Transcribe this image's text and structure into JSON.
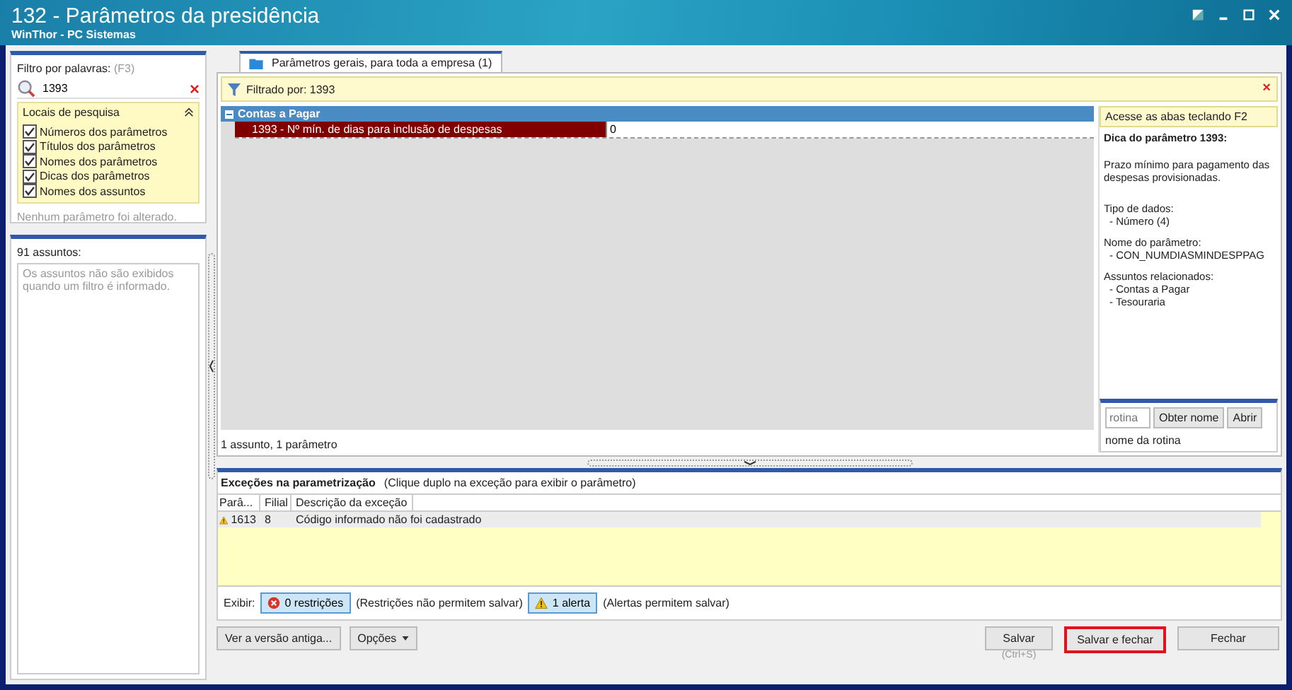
{
  "window": {
    "title": "132 - Parâmetros da presidência",
    "subtitle": "WinThor - PC Sistemas"
  },
  "filter": {
    "label": "Filtro por palavras:",
    "shortcut": "(F3)",
    "value": "1393",
    "clear": "×"
  },
  "search_places": {
    "title": "Locais de pesquisa",
    "expanded": true,
    "options": [
      {
        "label": "Números dos parâmetros",
        "checked": true
      },
      {
        "label": "Títulos dos parâmetros",
        "checked": true
      },
      {
        "label": "Nomes dos parâmetros",
        "checked": true
      },
      {
        "label": "Dicas dos parâmetros",
        "checked": true
      },
      {
        "label": "Nomes dos assuntos",
        "checked": true
      }
    ]
  },
  "changes_note": "Nenhum parâmetro foi alterado.",
  "subjects": {
    "title": "91 assuntos:",
    "message": "Os assuntos não são exibidos quando um filtro é informado."
  },
  "tabs": [
    {
      "label": "Parâmetros gerais, para toda a empresa  (1)",
      "selected": true
    }
  ],
  "filter_bar": {
    "text": "Filtrado por: 1393",
    "clear": "×"
  },
  "groups": [
    {
      "title": "Contas a Pagar",
      "expanded": true,
      "rows": [
        {
          "label": "1393 - Nº mín. de dias para inclusão de despesas",
          "value": "0",
          "selected": true
        }
      ]
    }
  ],
  "grid_status": "1 assunto, 1 parâmetro",
  "tip": {
    "hint": "Acesse as abas teclando F2",
    "title": "Dica do parâmetro 1393:",
    "description": "Prazo mínimo para pagamento das despesas provisionadas.",
    "sections": [
      {
        "heading": "Tipo de dados:",
        "items": [
          "- Número (4)"
        ]
      },
      {
        "heading": "Nome do parâmetro:",
        "items": [
          "- CON_NUMDIASMINDESPPAG"
        ]
      },
      {
        "heading": "Assuntos relacionados:",
        "items": [
          "- Contas a Pagar",
          "- Tesouraria"
        ]
      }
    ]
  },
  "routine": {
    "placeholder": "rotina",
    "get_name": "Obter nome",
    "open": "Abrir",
    "name": "nome da rotina"
  },
  "exceptions": {
    "title": "Exceções na parametrização",
    "hint": "(Clique duplo na exceção para exibir o parâmetro)",
    "columns": [
      "Parâ...",
      "Filial",
      "Descrição da exceção"
    ],
    "rows": [
      {
        "kind": "alert",
        "cells": [
          "1613",
          "8",
          "Código informado não foi cadastrado"
        ],
        "selected": true
      }
    ]
  },
  "show": {
    "label": "Exibir:",
    "filters": [
      {
        "kind": "error",
        "label": "0 restrições",
        "note": "(Restrições não permitem salvar)",
        "pressed": true
      },
      {
        "kind": "alert",
        "label": "1 alerta",
        "note": "(Alertas permitem salvar)",
        "pressed": true
      }
    ]
  },
  "footer": {
    "left": [
      {
        "label": "Ver a versão antiga...",
        "dropdown": false
      },
      {
        "label": "Opções",
        "dropdown": true
      }
    ],
    "right": [
      {
        "label": "Salvar",
        "shortcut": "(Ctrl+S)",
        "highlighted": false
      },
      {
        "label": "Salvar e fechar",
        "highlighted": true
      },
      {
        "label": "Fechar",
        "highlighted": false
      }
    ]
  }
}
